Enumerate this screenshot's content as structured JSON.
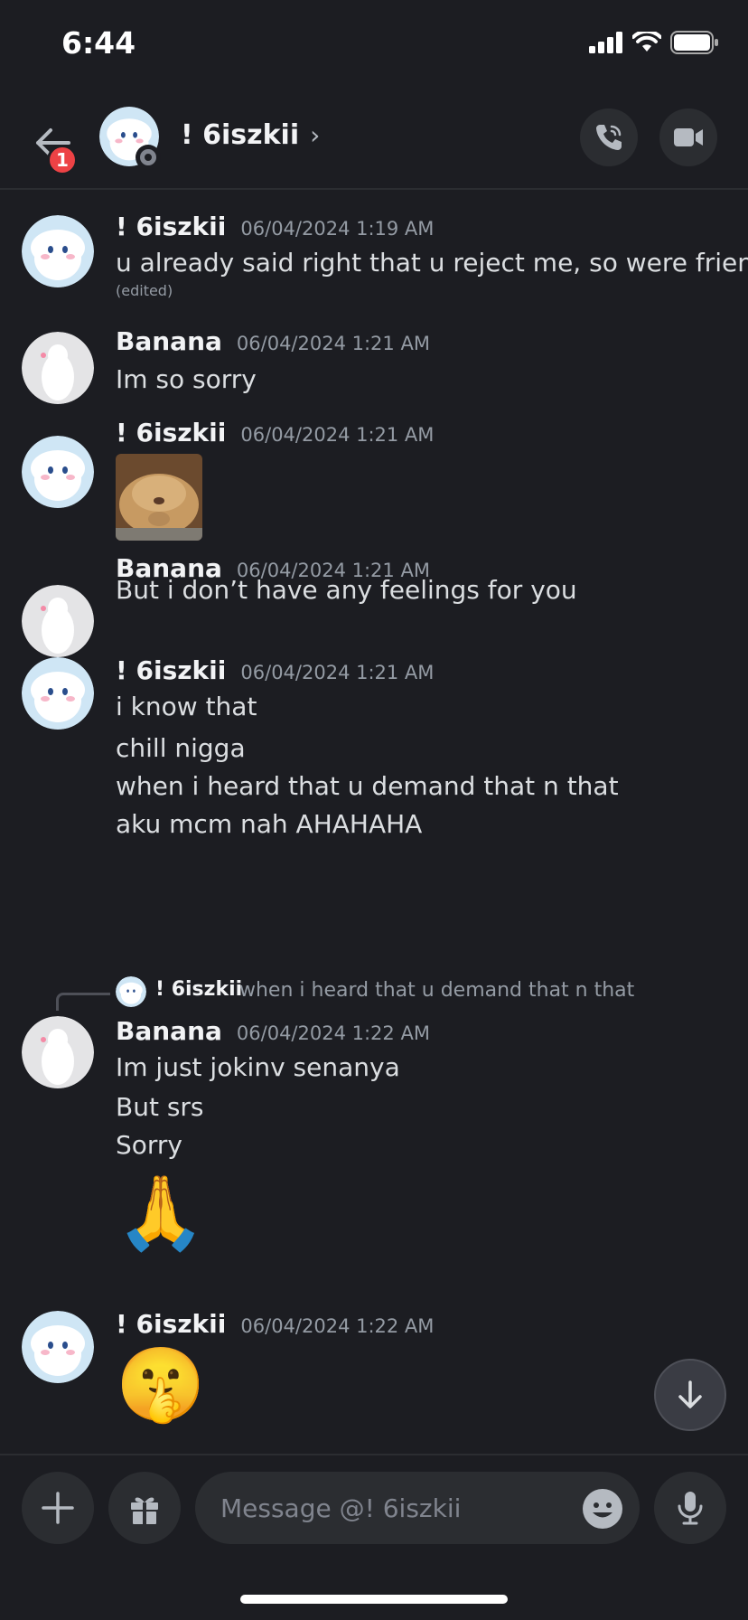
{
  "status_bar": {
    "time": "6:44"
  },
  "header": {
    "badge_count": "1",
    "name": "! 6iszkii",
    "chevron": "›",
    "icons": [
      "back-arrow-icon",
      "phone-call-icon",
      "video-camera-icon"
    ]
  },
  "messages": [
    {
      "author": "! 6iszkii",
      "timestamp": "06/04/2024 1:19 AM",
      "lines": [
        "u already said right that u reject me, so were friends"
      ],
      "edited": "(edited)"
    },
    {
      "author": "Banana",
      "timestamp": "06/04/2024 1:21 AM",
      "lines": [
        "Im so sorry"
      ]
    },
    {
      "author": "! 6iszkii",
      "timestamp": "06/04/2024 1:21 AM",
      "image": "cat-face-image"
    },
    {
      "author": "Banana",
      "timestamp": "06/04/2024 1:21 AM",
      "lines": [
        "But i don’t have any feelings for you"
      ]
    },
    {
      "author": "! 6iszkii",
      "timestamp": "06/04/2024 1:21 AM",
      "lines": [
        "i know that",
        "chill nigga",
        "when i heard that u demand that n that",
        "aku mcm nah AHAHAHA"
      ]
    },
    {
      "reply": {
        "author": "! 6iszkii",
        "text": "when i heard that u demand that n that"
      },
      "author": "Banana",
      "timestamp": "06/04/2024 1:22 AM",
      "lines": [
        "Im just jokinv senanya",
        "But srs",
        "Sorry"
      ],
      "emoji": "🙏"
    },
    {
      "author": "! 6iszkii",
      "timestamp": "06/04/2024 1:22 AM",
      "emoji": "🤫"
    }
  ],
  "composer": {
    "placeholder": "Message @! 6iszkii",
    "icons": [
      "plus-icon",
      "gift-icon",
      "emoji-icon",
      "microphone-icon"
    ]
  },
  "colors": {
    "background": "#1c1d22",
    "surface": "#2b2d31",
    "badge": "#ed4245",
    "muted": "#949ba4"
  }
}
